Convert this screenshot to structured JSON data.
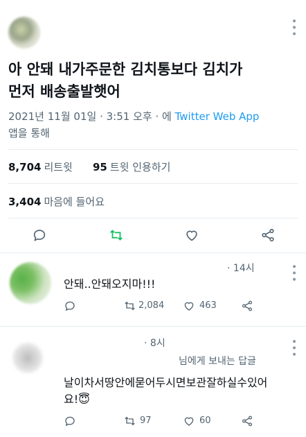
{
  "tweet": {
    "text_line1": "아 안돼 내가주문한 김치통보다 김치가",
    "text_line2": "먼저 배송출발햇어",
    "date": "2021년 11월 01일",
    "time": "3:51 오후",
    "via_prefix": "에",
    "client": "Twitter Web App",
    "via_suffix": "앱을 통해",
    "retweets_count": "8,704",
    "retweets_label": "리트윗",
    "quotes_count": "95",
    "quotes_label": "트윗 인용하기",
    "likes_count": "3,404",
    "likes_label": "마음에 들어요"
  },
  "replies": [
    {
      "time": "14시",
      "text": "안돼..안돼오지마!!!",
      "retweets": "2,084",
      "likes": "463"
    },
    {
      "time": "8시",
      "context": "님에게 보내는 답글",
      "text_line1": "날이차서땅안에묻어두시면보관잘하실수있어",
      "text_line2": "요!",
      "emoji": "😇",
      "retweets": "97",
      "likes": "60"
    }
  ],
  "icons": {
    "reply": "reply-icon",
    "retweet": "retweet-icon",
    "like": "heart-icon",
    "share": "share-icon",
    "more": "more-icon"
  },
  "colors": {
    "retweet_active": "#17bf63",
    "link": "#1d9bf0",
    "muted": "#536471"
  }
}
